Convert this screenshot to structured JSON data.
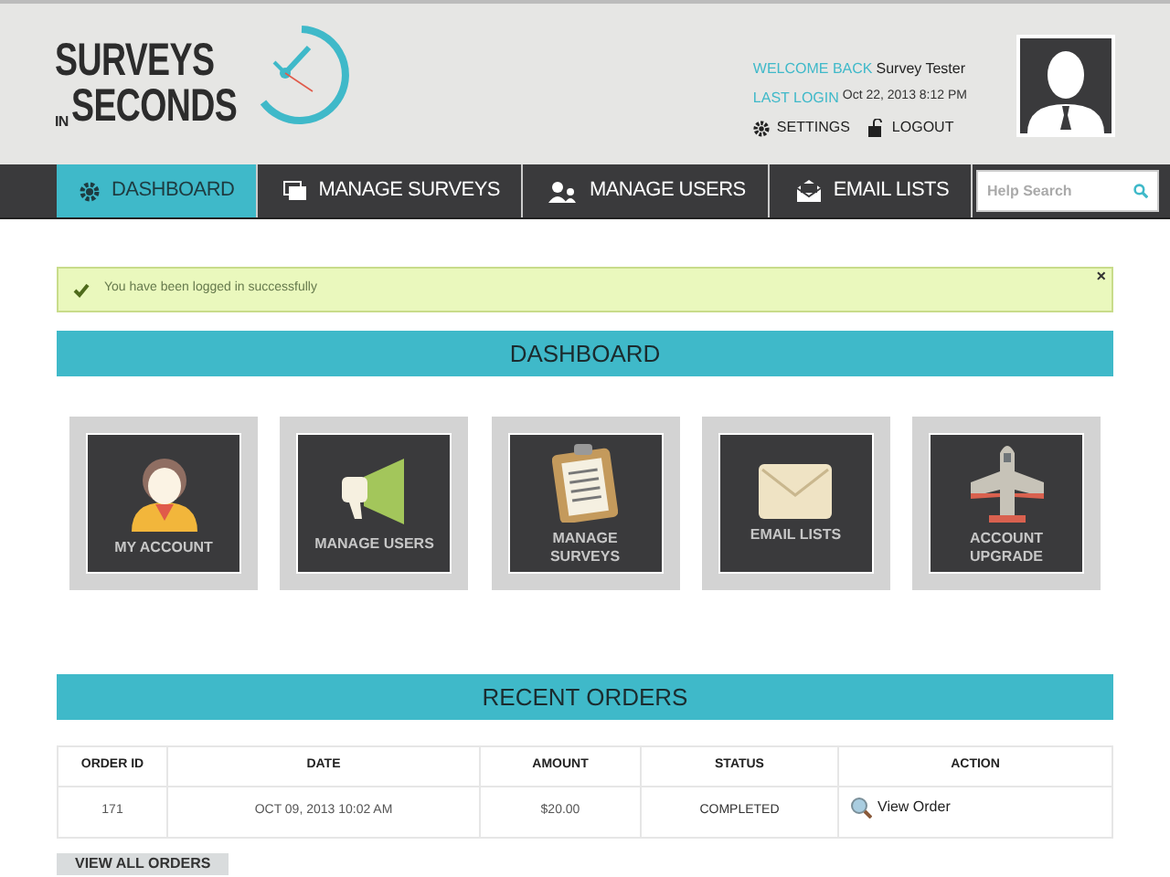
{
  "logo": {
    "line1": "SURVEYS",
    "small": "IN",
    "line2": "SECONDS"
  },
  "user": {
    "welcome_label": "WELCOME BACK",
    "name": "Survey Tester",
    "last_login_label": "LAST LOGIN",
    "last_login": "Oct 22, 2013 8:12 PM",
    "links": [
      "SETTINGS",
      "LOGOUT"
    ]
  },
  "nav": [
    {
      "label": "DASHBOARD",
      "selected": true
    },
    {
      "label": "MANAGE SURVEYS",
      "selected": false
    },
    {
      "label": "MANAGE USERS",
      "selected": false
    },
    {
      "label": "EMAIL LISTS",
      "selected": false
    }
  ],
  "search": {
    "placeholder": "Help Search"
  },
  "alert": {
    "message": "You have been logged in successfully",
    "close": "×"
  },
  "dashboard": {
    "title": "DASHBOARD",
    "tiles": [
      "MY ACCOUNT",
      "MANAGE USERS",
      "MANAGE SURVEYS",
      "EMAIL LISTS",
      "ACCOUNT UPGRADE"
    ]
  },
  "orders": {
    "title": "RECENT ORDERS",
    "columns": [
      "ORDER ID",
      "DATE",
      "AMOUNT",
      "STATUS",
      "ACTION"
    ],
    "rows": [
      {
        "order_id": "171",
        "date": "OCT 09, 2013 10:02 AM",
        "amount": "$20.00",
        "status": "COMPLETED",
        "action": "View Order"
      }
    ],
    "view_all": "VIEW ALL ORDERS"
  }
}
